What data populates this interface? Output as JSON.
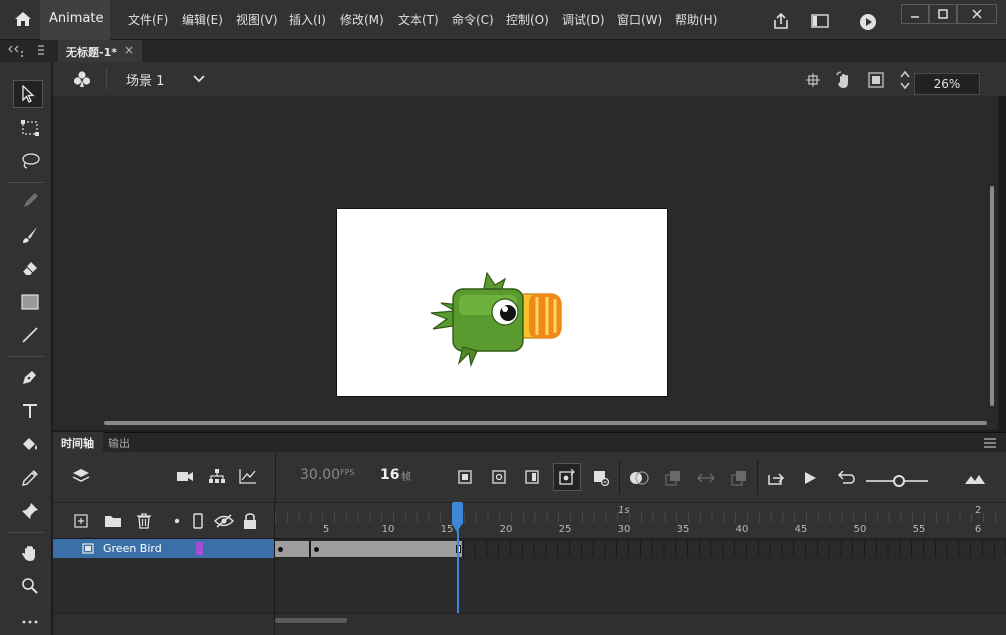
{
  "app": {
    "name": "Animate"
  },
  "menu": [
    "文件(F)",
    "编辑(E)",
    "视图(V)",
    "插入(I)",
    "修改(M)",
    "文本(T)",
    "命令(C)",
    "控制(O)",
    "调试(D)",
    "窗口(W)",
    "帮助(H)"
  ],
  "document": {
    "tab_label": "无标题-1*",
    "close_glyph": "×"
  },
  "scene": {
    "label": "场景 1",
    "zoom": "26%"
  },
  "timeline": {
    "tab_timeline": "时间轴",
    "tab_output": "输出",
    "fps_value": "30.00",
    "fps_unit": "FPS",
    "current_frame": "16",
    "frame_unit": "帧",
    "ruler_labels": [
      "5",
      "10",
      "15",
      "20",
      "25",
      "30",
      "35",
      "40",
      "45",
      "50",
      "55",
      "6"
    ],
    "time_markers": [
      "1s",
      "2"
    ],
    "layer": {
      "name": "Green Bird",
      "color": "#a24fd6"
    }
  },
  "colors": {
    "accent": "#3a6fa8",
    "playhead": "#3d86d8",
    "bird_green": "#5b9a2f",
    "beak_orange": "#f08a14"
  }
}
